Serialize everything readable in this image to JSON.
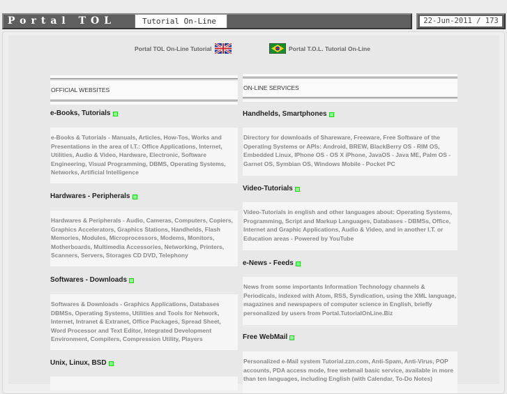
{
  "header": {
    "logo": "Portal TOL",
    "tagline": "Tutorial On-Line",
    "date_counter": "22-Jun-2011 / 173"
  },
  "languages": [
    {
      "label": "Portal TOL On-Line Tutorial",
      "flag": "uk-flag"
    },
    {
      "label": "Portal T.O.L. Tutorial On-Line",
      "flag": "brazil-flag"
    }
  ],
  "left": {
    "title": "OFFICIAL WEBSITES",
    "items": [
      {
        "heading": "e-Books, Tutorials",
        "desc": "e-Books & Tutorials - Manuals, Articles, How-Tos, Works and Presentations in the area of I.T.: Office Applications, Internet, Utilities, Audio & Video, Hardware, Electronic, Software Engineering, Visual Programming, DBMS, Operating Systems, Networks, Artificial Intelligence"
      },
      {
        "heading": "Hardwares - Peripherals",
        "desc": "Hardwares & Peripherals - Audio, Cameras, Computers, Copiers, Graphics Accelerators, Graphics Stations, Handhelds, Flash Memories, Modules, Microprocessors, Modems, Monitors, Motherboards, Multimedia Accessories, Networking, Printers, Scanners, Servers, Storages CD DVD, Telephony"
      },
      {
        "heading": "Softwares - Downloads",
        "desc": "Softwares & Downloads - Graphics Applications, Databases DBMSs, Operating Systems, Utilities and Tools for Network, Internet, Intranet & Extranet, Office Packages, Spread Sheet, Word Processor and Text Editor, Integrated Development Environment, Compilers, Compression Utility, Players"
      },
      {
        "heading": "Unix, Linux, BSD"
      }
    ]
  },
  "right": {
    "title": "ON-LINE SERVICES",
    "items": [
      {
        "heading": "Handhelds, Smartphones",
        "desc": "Directory for downloads of Shareware, Freeware, Free Software of the Operating Systems or APIs: Android, BREW, BlackBerry OS - RIM OS, Embedded Linux, IPhone OS - OS X iPhone, JavaOS - Java ME, Palm OS - Garnet OS, Symbian OS, Windows Mobile - Pocket PC"
      },
      {
        "heading": "Video-Tutorials",
        "desc": "Video-Tutorials in english and other languages about: Operating Systems, Programming, Script and Markup Languages, Databases - DBMSs, Office, Internet and Graphic Applications, Audio & Video, and in another I.T. or Education areas - Powered by YouTube"
      },
      {
        "heading": "e-News - Feeds",
        "desc": "News from some importants Information Technology channels & Periodicals, indexed with Atom, RSS, Syndication, using the XML language, magazines and newspapers of computer science in English, briefly personalized by users from Portal.TutorialOnLine.Biz"
      },
      {
        "heading": "Free WebMail",
        "desc": "Personalized e-Mail system Tutorial.zzn.com, Anti-Spam, Anti-Virus, POP accounts, PDA access mode, free webmail basic service, available in more than ten languages, including English (with Calendar, To-Do Notes)"
      }
    ]
  }
}
